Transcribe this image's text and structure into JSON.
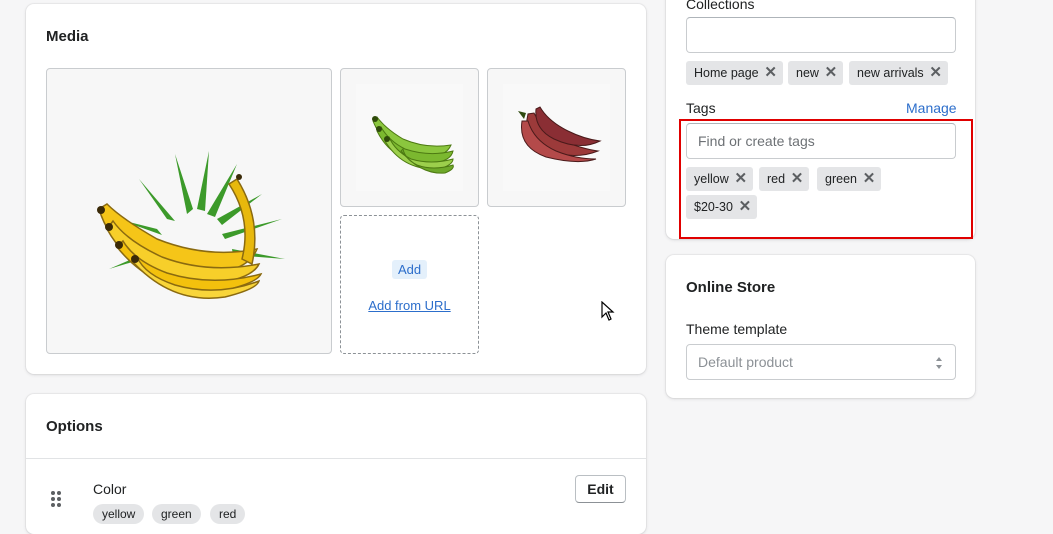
{
  "media": {
    "title": "Media",
    "add_label": "Add",
    "add_from_url_label": "Add from URL"
  },
  "options": {
    "title": "Options",
    "option_name": "Color",
    "edit_label": "Edit",
    "values": [
      "yellow",
      "green",
      "red"
    ]
  },
  "organization": {
    "collections_label": "Collections",
    "collections_value": "",
    "collections": [
      "Home page",
      "new",
      "new arrivals"
    ],
    "tags_label": "Tags",
    "manage_label": "Manage",
    "tags_placeholder": "Find or create tags",
    "tags": [
      "yellow",
      "red",
      "green",
      "$20-30"
    ]
  },
  "online_store": {
    "title": "Online Store",
    "theme_template_label": "Theme template",
    "theme_template_value": "Default product"
  },
  "colors": {
    "highlight": "#e00000",
    "link": "#2c6ecb"
  }
}
